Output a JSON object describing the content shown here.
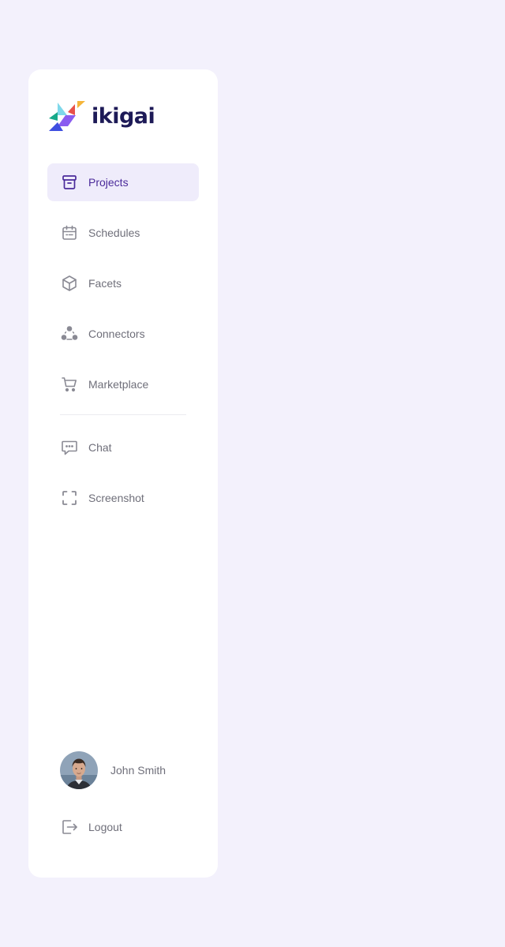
{
  "brand": {
    "name": "ikigai",
    "logo_icon": "tangram-bird-logo"
  },
  "colors": {
    "page_background": "#f3f1fc",
    "sidebar_background": "#ffffff",
    "active_item_background": "#efecfb",
    "active_item_text": "#4a2a9a",
    "item_text": "#6f6f7a",
    "brand_text": "#1d1a57"
  },
  "nav": {
    "items": [
      {
        "label": "Projects",
        "icon": "archive-box-icon",
        "active": true
      },
      {
        "label": "Schedules",
        "icon": "calendar-icon",
        "active": false
      },
      {
        "label": "Facets",
        "icon": "cube-icon",
        "active": false
      },
      {
        "label": "Connectors",
        "icon": "connectors-dots-icon",
        "active": false
      },
      {
        "label": "Marketplace",
        "icon": "shopping-cart-icon",
        "active": false
      }
    ],
    "secondary_items": [
      {
        "label": "Chat",
        "icon": "chat-bubble-icon"
      },
      {
        "label": "Screenshot",
        "icon": "screenshot-frame-icon"
      }
    ]
  },
  "user": {
    "name": "John Smith",
    "avatar_icon": "user-avatar"
  },
  "footer": {
    "logout_label": "Logout",
    "logout_icon": "logout-icon"
  }
}
